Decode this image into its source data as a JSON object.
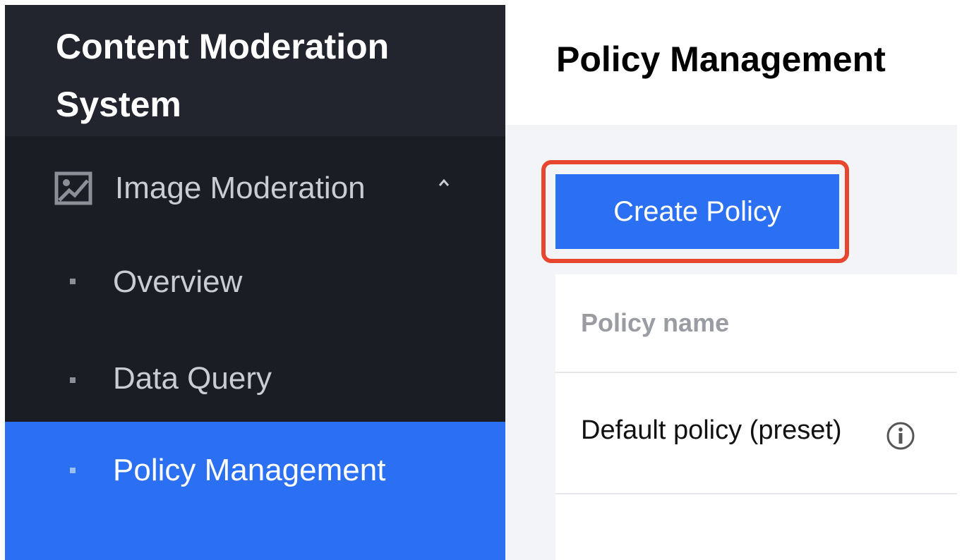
{
  "sidebar": {
    "app_title": "Content Moderation System",
    "group": {
      "icon": "image-icon",
      "label": "Image Moderation",
      "chevron": "chevron-up-icon"
    },
    "items": [
      {
        "label": "Overview",
        "active": false
      },
      {
        "label": "Data Query",
        "active": false
      },
      {
        "label": "Policy Management",
        "active": true
      }
    ]
  },
  "header": {
    "title": "Policy Management"
  },
  "toolbar": {
    "create_label": "Create Policy"
  },
  "table": {
    "columns": [
      "Policy name"
    ],
    "rows": [
      {
        "name": "Default policy (preset)",
        "icon": "info-icon"
      }
    ]
  },
  "colors": {
    "sidebar_bg": "#1b1d24",
    "accent": "#2b6ff2",
    "highlight": "#e8472f"
  }
}
